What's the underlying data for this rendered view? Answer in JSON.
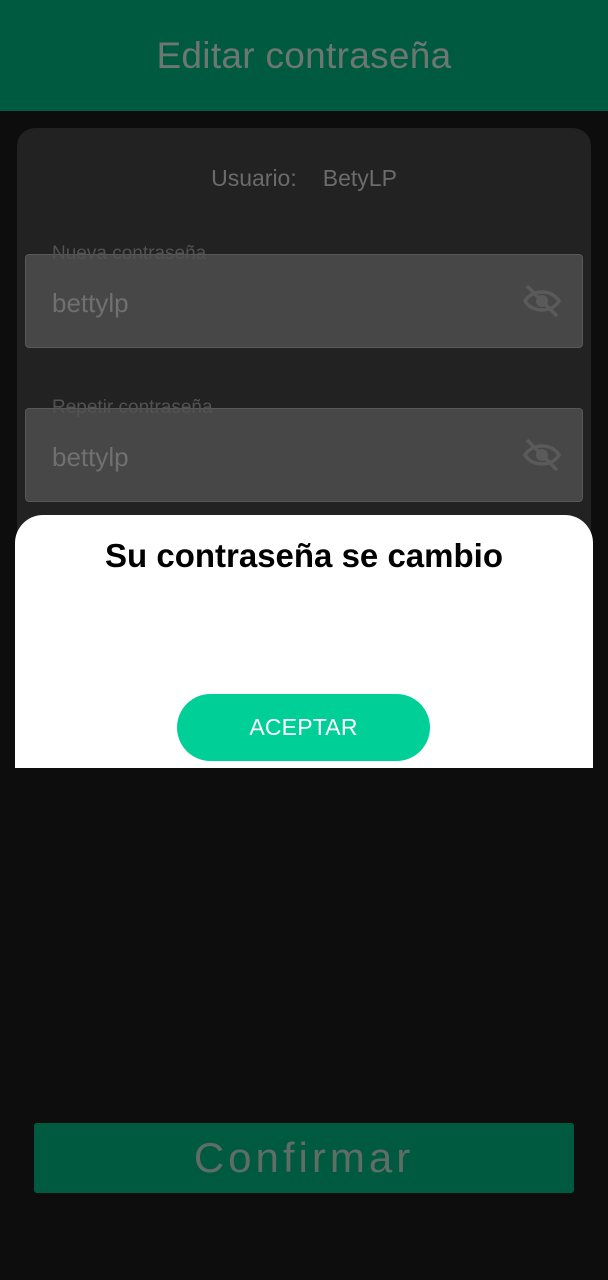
{
  "header": {
    "title": "Editar contraseña"
  },
  "user": {
    "label": "Usuario:",
    "value": "BetyLP"
  },
  "new_password": {
    "label": "Nueva contraseña",
    "value": "bettylp",
    "toggle_icon": "eye-off-icon"
  },
  "repeat_password": {
    "label": "Repetir contraseña",
    "value": "bettylp",
    "toggle_icon": "eye-off-icon"
  },
  "dialog": {
    "message": "Su contraseña se cambio",
    "accept_label": "ACEPTAR"
  },
  "footer": {
    "confirm_label": "Confirmar"
  },
  "colors": {
    "primary": "#005a40",
    "accent": "#00cf98",
    "background": "#0d0d0d"
  }
}
